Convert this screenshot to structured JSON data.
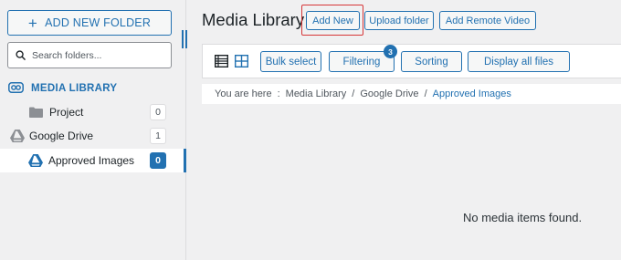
{
  "sidebar": {
    "add_folder_label": "ADD NEW FOLDER",
    "add_folder_icon": "plus-icon",
    "search_placeholder": "Search folders...",
    "items": [
      {
        "label": "MEDIA LIBRARY",
        "icon": "media-library-icon"
      },
      {
        "label": "Project",
        "icon": "folder-icon",
        "count": "0"
      },
      {
        "label": "Google Drive",
        "icon": "google-drive-icon",
        "count": "1"
      },
      {
        "label": "Approved Images",
        "icon": "google-drive-icon",
        "count": "0",
        "active": true
      }
    ]
  },
  "header": {
    "title": "Media Library",
    "add_new_label": "Add New",
    "upload_folder_label": "Upload folder",
    "add_remote_video_label": "Add Remote Video"
  },
  "toolbar": {
    "view_icons": [
      "list-view-icon",
      "grid-view-icon"
    ],
    "bulk_select_label": "Bulk select",
    "filtering_label": "Filtering",
    "filtering_badge": "3",
    "sorting_label": "Sorting",
    "display_all_label": "Display all files"
  },
  "breadcrumb": {
    "prefix": "You are here",
    "items": [
      "Media Library",
      "Google Drive",
      "Approved Images"
    ]
  },
  "empty_message": "No media items found.",
  "colors": {
    "accent": "#2271b1",
    "highlight": "#d63638",
    "background": "#f0f0f1"
  }
}
